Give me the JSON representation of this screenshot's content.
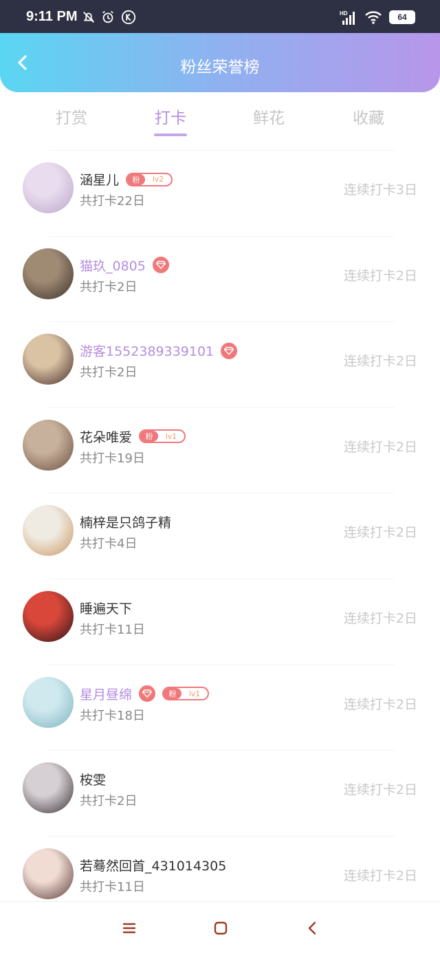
{
  "status_bar": {
    "time": "9:11 PM",
    "battery": "64",
    "network": "HD"
  },
  "header": {
    "title": "粉丝荣誉榜"
  },
  "tabs": [
    {
      "label": "打赏",
      "active": false
    },
    {
      "label": "打卡",
      "active": true
    },
    {
      "label": "鲜花",
      "active": false
    },
    {
      "label": "收藏",
      "active": false
    }
  ],
  "fans": [
    {
      "name": "涵星儿",
      "vip": false,
      "gem": false,
      "fan_badge": {
        "label": "粉",
        "level": "lv2"
      },
      "total": "共打卡22日",
      "streak": "连续打卡3日",
      "avatar_colors": [
        "#e9dcee",
        "#b9a6c9"
      ]
    },
    {
      "name": "猫玖_0805",
      "vip": true,
      "gem": true,
      "fan_badge": null,
      "total": "共打卡2日",
      "streak": "连续打卡2日",
      "avatar_colors": [
        "#9f8a74",
        "#3d3129"
      ]
    },
    {
      "name": "游客1552389339101",
      "vip": true,
      "gem": true,
      "fan_badge": null,
      "total": "共打卡2日",
      "streak": "连续打卡2日",
      "avatar_colors": [
        "#d9c3a4",
        "#4a2c2a"
      ]
    },
    {
      "name": "花朵唯爱",
      "vip": false,
      "gem": false,
      "fan_badge": {
        "label": "粉",
        "level": "lv1"
      },
      "total": "共打卡19日",
      "streak": "连续打卡2日",
      "avatar_colors": [
        "#c8b19c",
        "#6a4f3e"
      ]
    },
    {
      "name": "楠梓是只鸽子精",
      "vip": false,
      "gem": false,
      "fan_badge": null,
      "total": "共打卡4日",
      "streak": "连续打卡2日",
      "avatar_colors": [
        "#f0ebe2",
        "#c89763"
      ]
    },
    {
      "name": "睡遍天下",
      "vip": false,
      "gem": false,
      "fan_badge": null,
      "total": "共打卡11日",
      "streak": "连续打卡2日",
      "avatar_colors": [
        "#d8473a",
        "#2a1418"
      ]
    },
    {
      "name": "星月昼绵",
      "vip": true,
      "gem": true,
      "fan_badge": {
        "label": "粉",
        "level": "lv1"
      },
      "total": "共打卡18日",
      "streak": "连续打卡2日",
      "avatar_colors": [
        "#cfe9ee",
        "#7fb2c0"
      ]
    },
    {
      "name": "桉雯",
      "vip": false,
      "gem": false,
      "fan_badge": null,
      "total": "共打卡2日",
      "streak": "连续打卡2日",
      "avatar_colors": [
        "#d6d0d4",
        "#3a3134"
      ]
    },
    {
      "name": "若蓦然回首_431014305",
      "vip": false,
      "gem": false,
      "fan_badge": null,
      "total": "共打卡11日",
      "streak": "连续打卡2日",
      "avatar_colors": [
        "#f1dcd4",
        "#5a3a36"
      ]
    }
  ],
  "nav": {
    "icons": [
      "menu-icon",
      "home-icon",
      "back-icon"
    ]
  },
  "colors": {
    "accent": "#b48ee0",
    "badge": "#f0787a",
    "header_start": "#5ad6f2",
    "header_end": "#b896ea"
  }
}
